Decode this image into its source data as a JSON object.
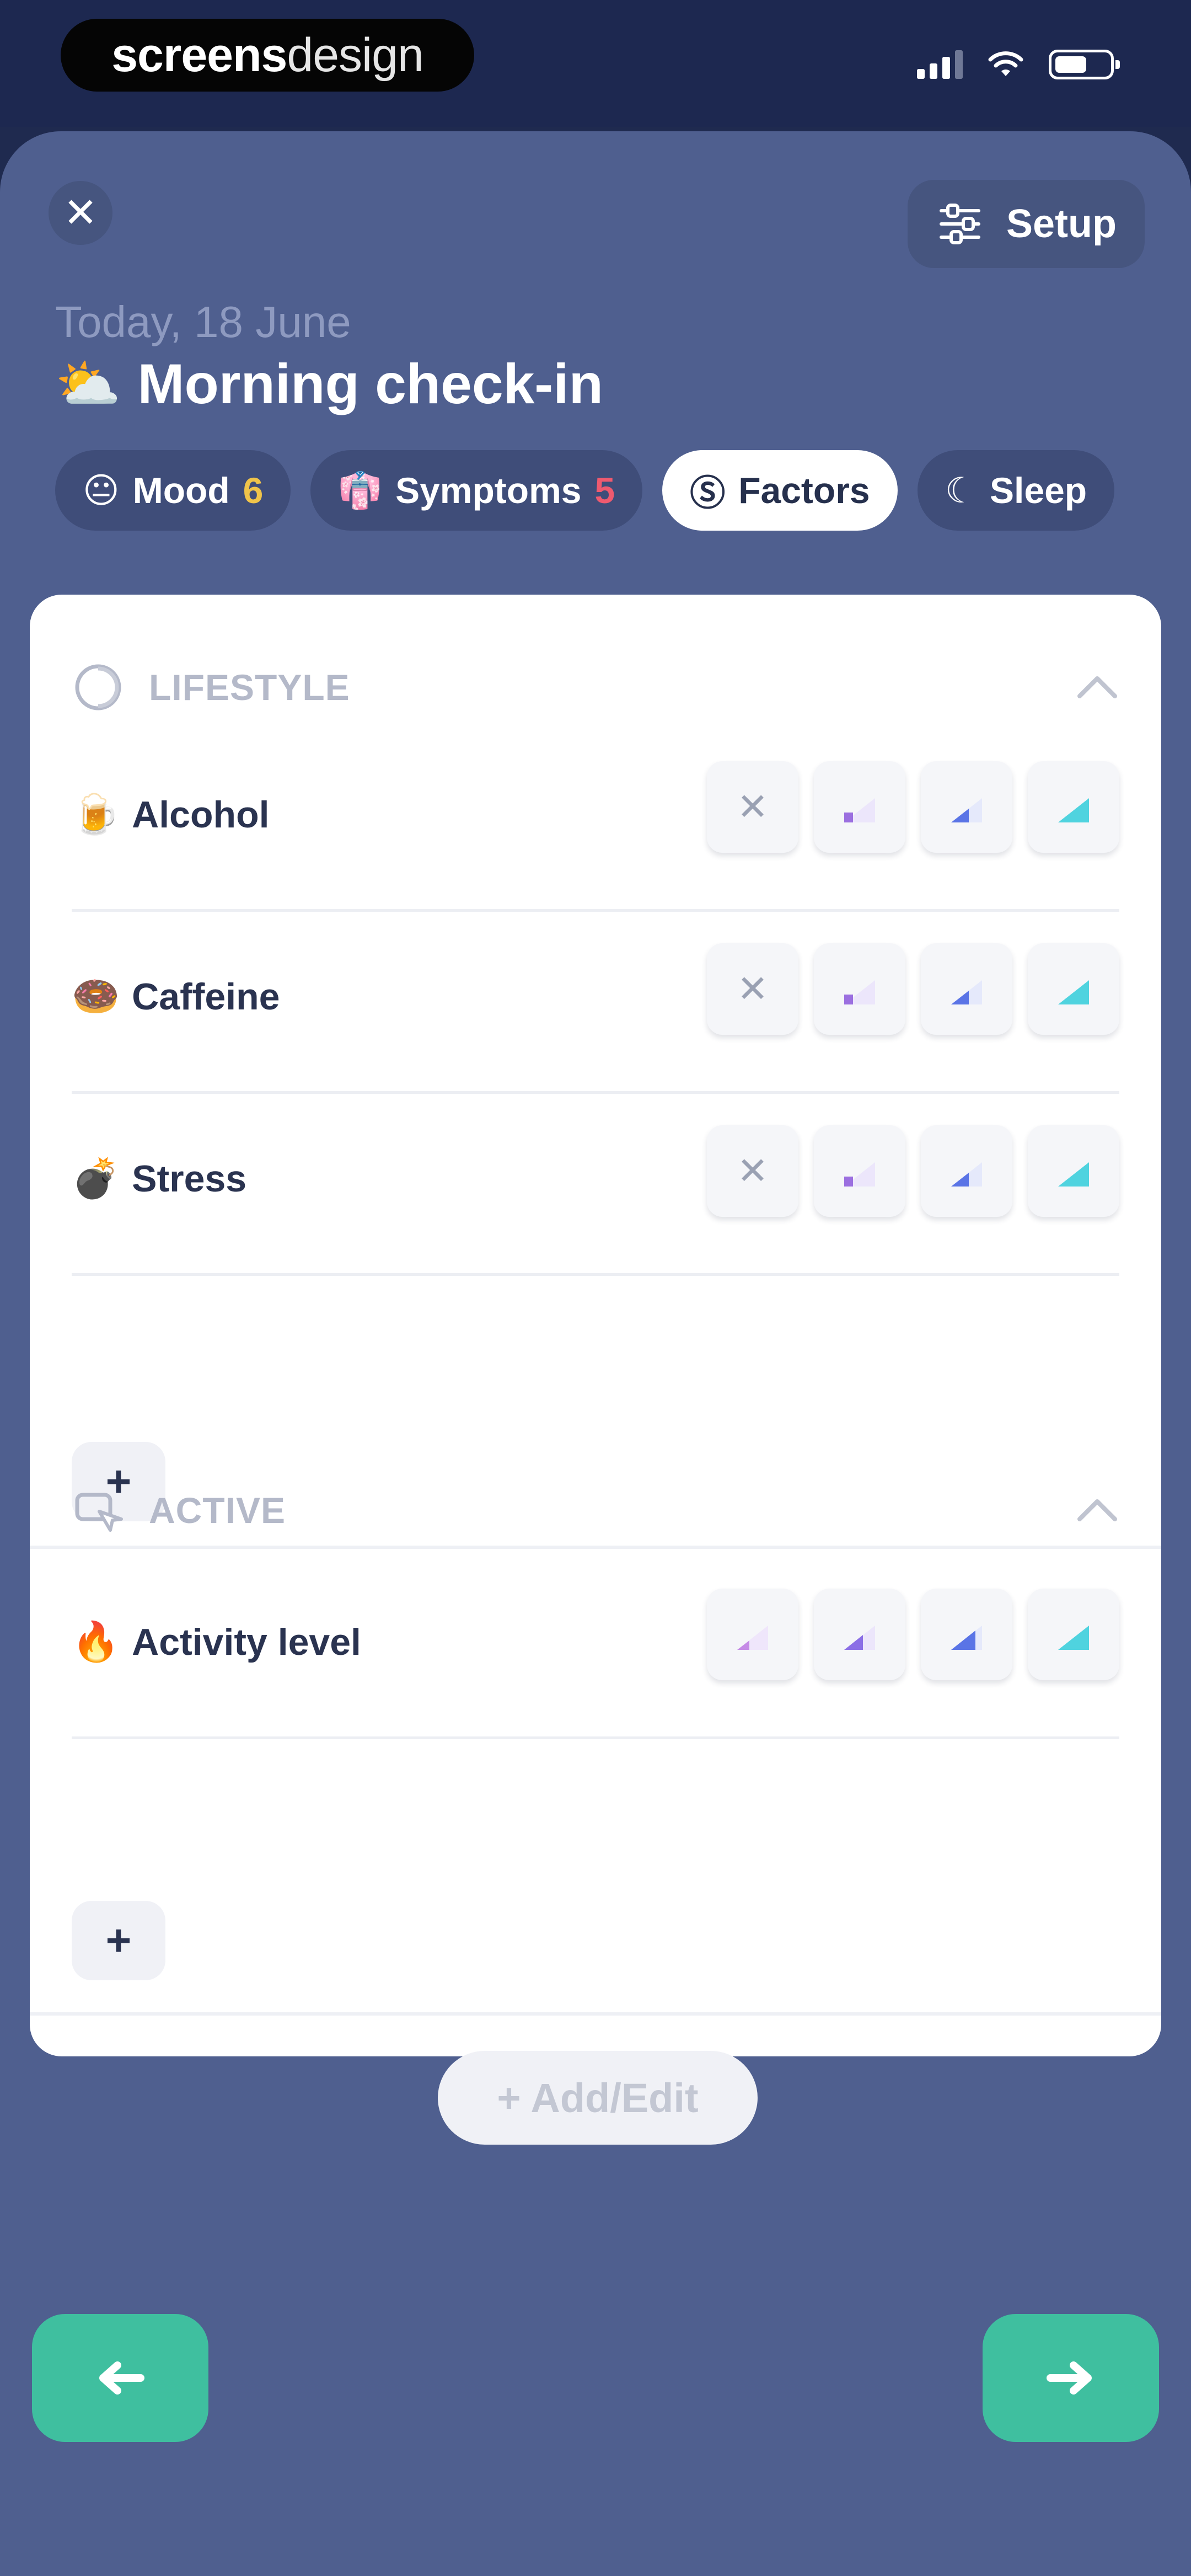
{
  "status_bar": {
    "brand_strong": "screens",
    "brand_light": "design",
    "icons": [
      "signal-icon",
      "wifi-icon",
      "battery-icon"
    ]
  },
  "header": {
    "close_icon": "close-icon",
    "setup_label": "Setup",
    "setup_icon": "sliders-icon",
    "date": "Today, 18 June",
    "title_emoji": "⛅",
    "title": "Morning check-in"
  },
  "tabs": [
    {
      "icon": "😐",
      "label": "Mood",
      "badge": "6",
      "active": false
    },
    {
      "icon": "👘",
      "label": "Symptoms",
      "badge": "5",
      "active": false
    },
    {
      "icon": "Ⓢ",
      "label": "Factors",
      "badge": "",
      "active": true
    },
    {
      "icon": "☾",
      "label": "Sleep",
      "badge": "",
      "active": false
    }
  ],
  "sections": [
    {
      "title": "LIFESTYLE",
      "icon": "lifestyle-icon",
      "items": [
        {
          "emoji": "🍺",
          "label": "Alcohol"
        },
        {
          "emoji": "🍩",
          "label": "Caffeine"
        },
        {
          "emoji": "💣",
          "label": "Stress"
        }
      ]
    },
    {
      "title": "ACTIVE",
      "icon": "active-icon",
      "items": [
        {
          "emoji": "🔥",
          "label": "Activity level"
        }
      ]
    }
  ],
  "add_label": "+",
  "add_edit_label": "+ Add/Edit",
  "colors": {
    "sheet": "#4f5f8f",
    "accent_green": "#3fbf9f",
    "level_low": "#9b6fe0",
    "level_mid": "#5a74e6",
    "level_high": "#4fd3df"
  },
  "nav": {
    "back_icon": "arrow-left-icon",
    "next_icon": "arrow-right-icon"
  }
}
